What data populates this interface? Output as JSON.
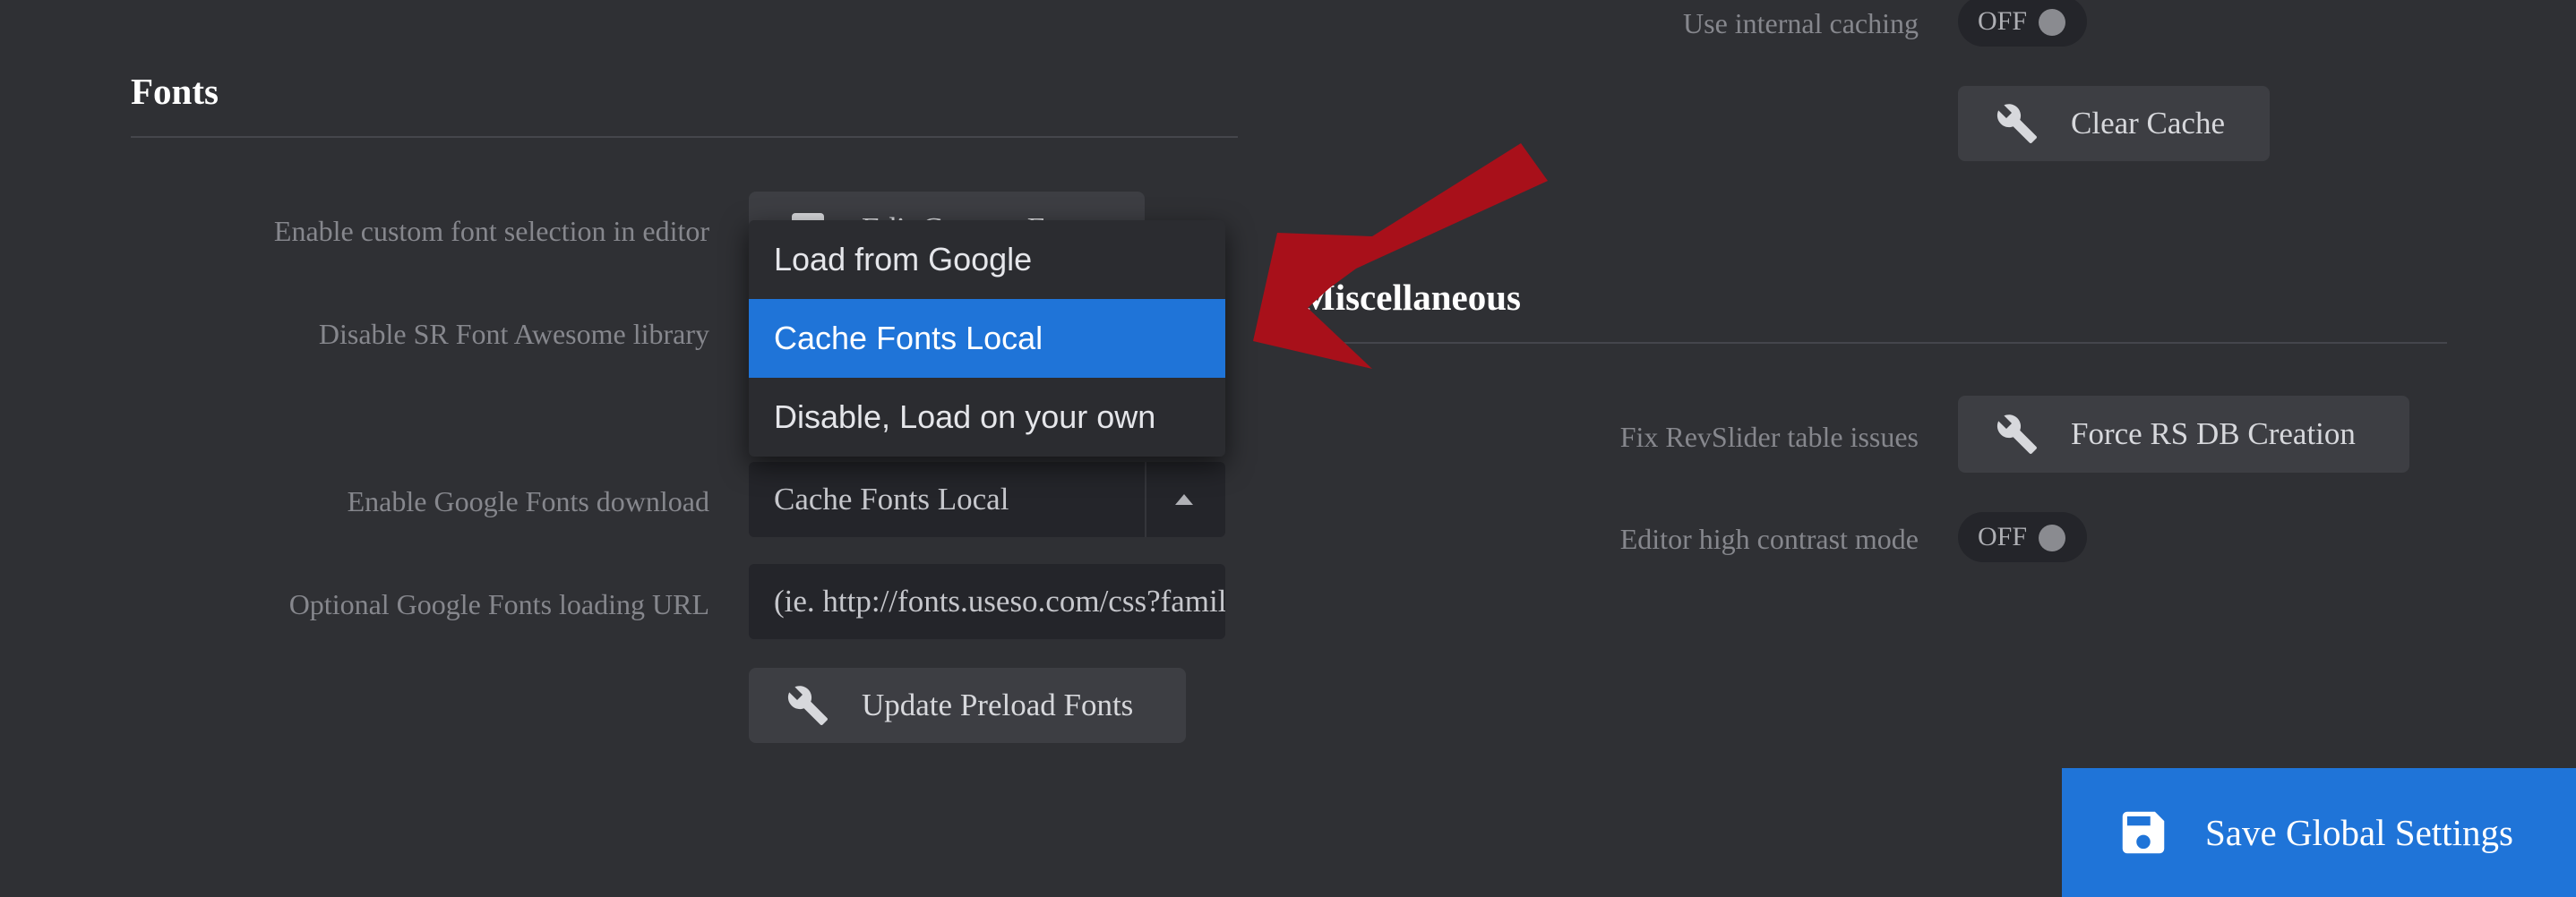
{
  "fonts": {
    "title": "Fonts",
    "custom_font_label": "Enable custom font selection in editor",
    "custom_font_button": "Edit Custom Fonts",
    "disable_fa_label": "Disable SR Font Awesome library",
    "google_download_label": "Enable Google Fonts download",
    "google_download_value": "Cache Fonts Local",
    "google_url_label": "Optional Google Fonts loading URL",
    "google_url_placeholder": "(ie. http://fonts.useso.com/css?family",
    "update_preload_button": "Update Preload Fonts"
  },
  "dropdown": {
    "options": [
      "Load from Google",
      "Cache Fonts Local",
      "Disable, Load on your own"
    ],
    "selected_index": 1
  },
  "cache": {
    "label": "Use internal caching",
    "toggle": "OFF",
    "clear_button": "Clear Cache"
  },
  "misc": {
    "title": "Miscellaneous",
    "fix_label": "Fix RevSlider table issues",
    "fix_button": "Force RS DB Creation",
    "contrast_label": "Editor high contrast mode",
    "contrast_toggle": "OFF"
  },
  "footer": {
    "save_button": "Save Global Settings"
  },
  "colors": {
    "background": "#2f3034",
    "accent": "#1f74d8",
    "arrow": "#a8101a"
  },
  "icons": {
    "wrench": "wrench-icon",
    "save": "floppy-disk-icon",
    "caret": "caret-up-icon"
  }
}
